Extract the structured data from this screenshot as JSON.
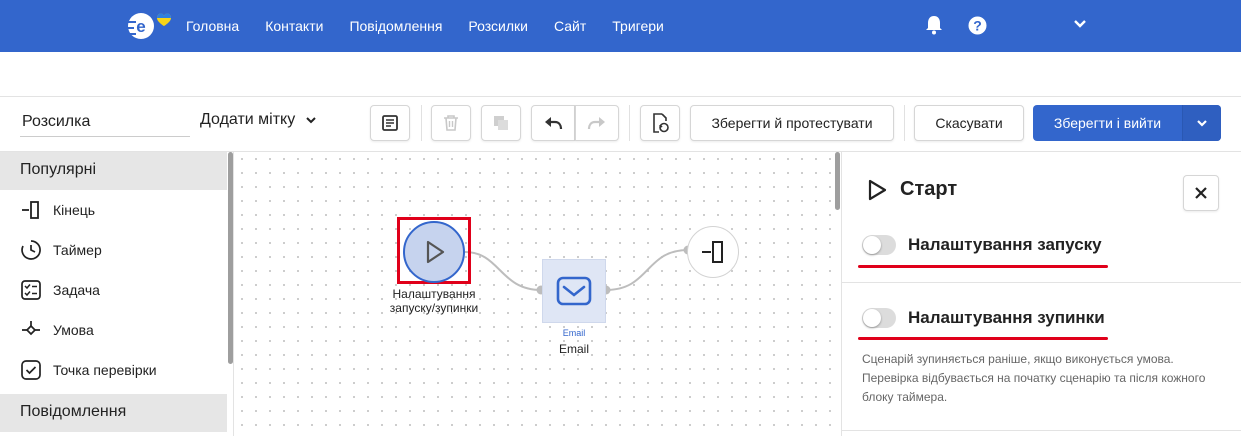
{
  "nav": {
    "links": [
      "Головна",
      "Контакти",
      "Повідомлення",
      "Розсилки",
      "Сайт",
      "Тригери"
    ],
    "brand_color": "#3366cc"
  },
  "toolbar": {
    "name_value": "Розсилка",
    "tag_label": "Додати мітку",
    "save_test_label": "Зберегти й протестувати",
    "cancel_label": "Скасувати",
    "save_exit_label": "Зберегти і вийти"
  },
  "palette": {
    "sections": [
      {
        "title": "Популярні"
      },
      {
        "title": "Повідомлення"
      }
    ],
    "items": [
      {
        "label": "Кінець",
        "icon": "end-icon"
      },
      {
        "label": "Таймер",
        "icon": "timer-icon"
      },
      {
        "label": "Задача",
        "icon": "task-icon"
      },
      {
        "label": "Умова",
        "icon": "condition-icon"
      },
      {
        "label": "Точка перевірки",
        "icon": "checkpoint-icon"
      }
    ]
  },
  "canvas": {
    "start_label": "Налаштування запуску/зупинки",
    "email_caption": "Email",
    "email_label": "Email"
  },
  "panel": {
    "title": "Старт",
    "launch_label": "Налаштування запуску",
    "stop_label": "Налаштування зупинки",
    "stop_desc": "Сценарій зупиняється раніше, якщо виконується умова. Перевірка відбувається на початку сценарію та після кожного блоку таймера."
  },
  "colors": {
    "highlight": "#e0001a",
    "accent": "#3366cc"
  }
}
